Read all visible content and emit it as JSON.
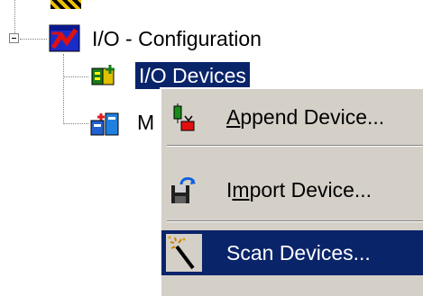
{
  "tree": {
    "root": {
      "label": "I/O - Configuration",
      "expander": "minus-icon",
      "icon": "io-configuration-icon"
    },
    "children": [
      {
        "label": "I/O Devices",
        "icon": "io-devices-icon",
        "selected": true
      },
      {
        "label": "M",
        "icon": "mappings-icon",
        "selected": false
      }
    ]
  },
  "context_menu": {
    "items": [
      {
        "label": "Append Device...",
        "icon": "append-device-icon",
        "highlighted": false
      },
      {
        "label": "Import Device...",
        "icon": "import-device-icon",
        "highlighted": false
      },
      {
        "label": "Scan Devices...",
        "icon": "scan-devices-icon",
        "highlighted": true
      }
    ]
  },
  "colors": {
    "selection": "#0a246a",
    "menu_background": "#d4d0c8",
    "window_background": "#ffffff"
  }
}
